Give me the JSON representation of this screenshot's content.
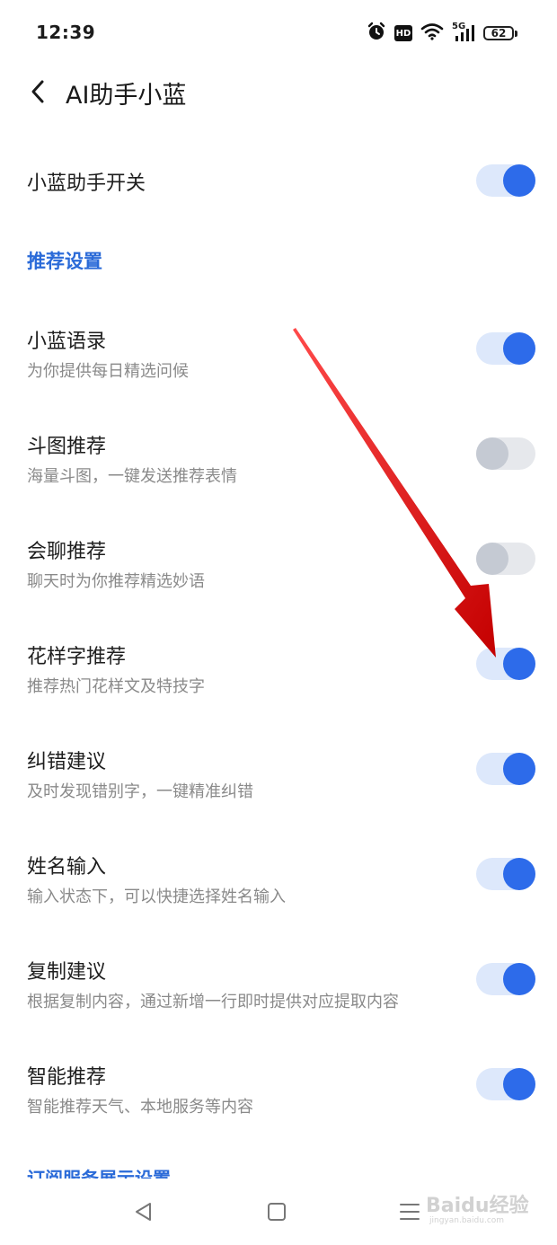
{
  "status_bar": {
    "time": "12:39",
    "hd_label": "HD",
    "network_label": "5G",
    "battery": "62",
    "icons": [
      "alarm-icon",
      "hd-icon",
      "wifi-icon",
      "signal-5g-icon",
      "battery-icon"
    ]
  },
  "header": {
    "title": "AI助手小蓝"
  },
  "master_switch": {
    "label": "小蓝助手开关",
    "on": true
  },
  "section": {
    "title": "推荐设置"
  },
  "items": [
    {
      "title": "小蓝语录",
      "subtitle": "为你提供每日精选问候",
      "on": true
    },
    {
      "title": "斗图推荐",
      "subtitle": "海量斗图，一键发送推荐表情",
      "on": false
    },
    {
      "title": "会聊推荐",
      "subtitle": "聊天时为你推荐精选妙语",
      "on": false
    },
    {
      "title": "花样字推荐",
      "subtitle": "推荐热门花样文及特技字",
      "on": true
    },
    {
      "title": "纠错建议",
      "subtitle": "及时发现错别字，一键精准纠错",
      "on": true
    },
    {
      "title": "姓名输入",
      "subtitle": "输入状态下，可以快捷选择姓名输入",
      "on": true
    },
    {
      "title": "复制建议",
      "subtitle": "根据复制内容，通过新增一行即时提供对应提取内容",
      "on": true
    },
    {
      "title": "智能推荐",
      "subtitle": "智能推荐天气、本地服务等内容",
      "on": true
    }
  ],
  "next_section": {
    "title": "订阅服务展示设置"
  },
  "nav": {
    "icons": [
      "back-triangle-icon",
      "home-square-icon",
      "menu-lines-icon"
    ]
  },
  "watermark": {
    "line1": "Baidu经验",
    "line2": "jingyan.baidu.com"
  },
  "colors": {
    "accent": "#2d6bea",
    "section_header": "#2a6ad8",
    "toggle_on_track": "#dde8fb",
    "toggle_off_track": "#e6e8ec",
    "toggle_off_knob": "#c5cad3",
    "annotation_arrow": "#e01010"
  }
}
